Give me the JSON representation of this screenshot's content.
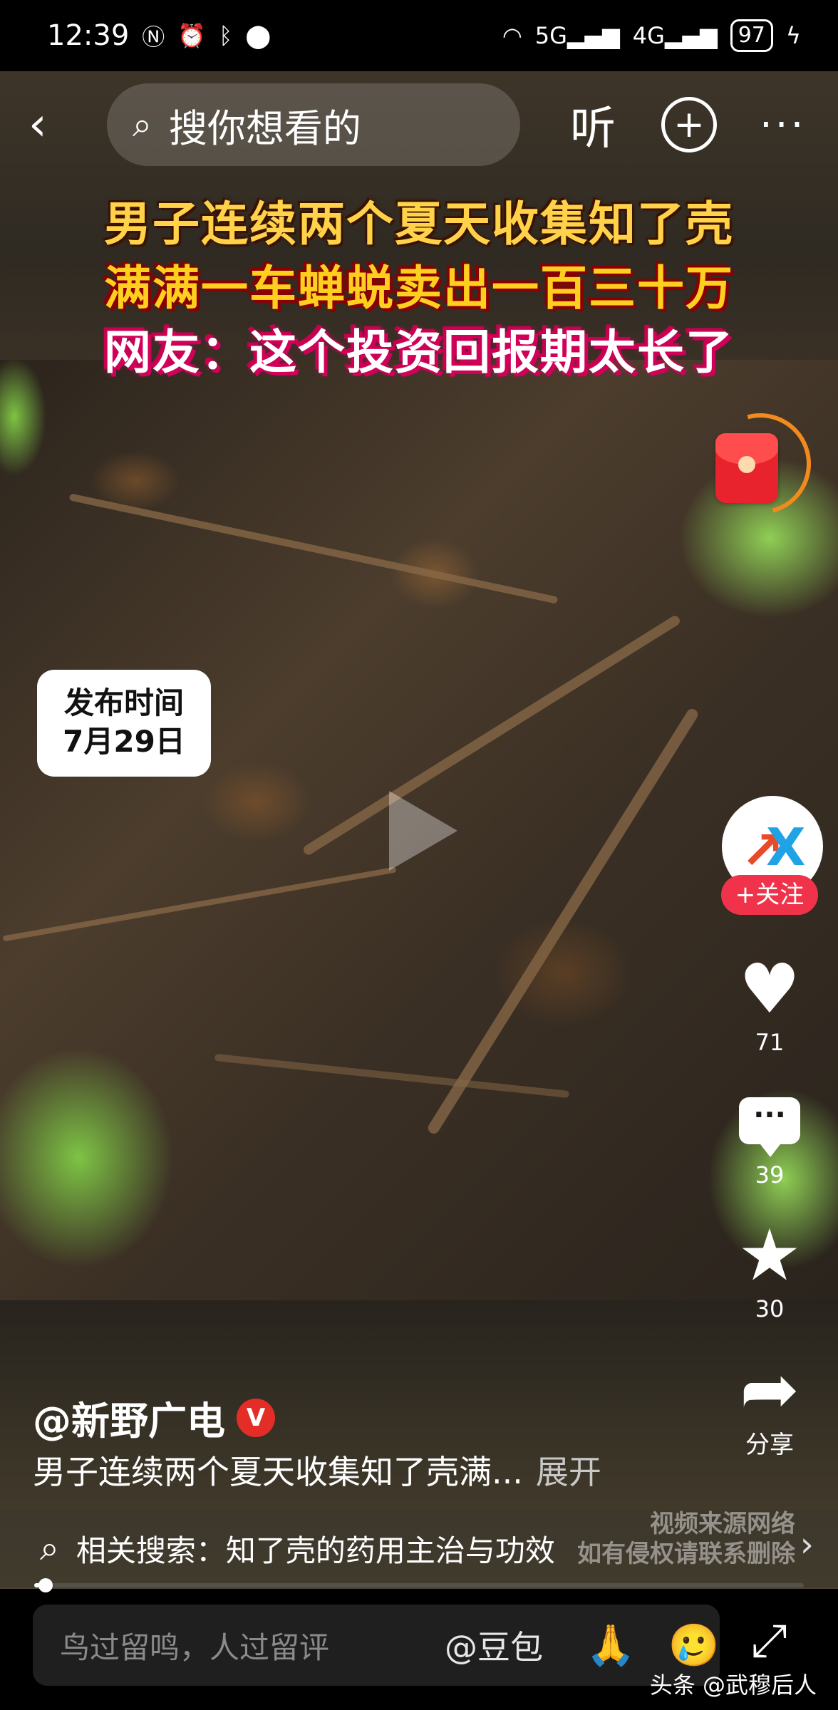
{
  "status_bar": {
    "time": "12:39",
    "left_icons": [
      "nfc-icon",
      "alarm-icon",
      "bluetooth-icon",
      "location-icon"
    ],
    "right_icons": [
      "wifi-icon",
      "signal-5g-icon",
      "signal-4g-icon"
    ],
    "network_5g": "5G",
    "network_4g": "4G",
    "battery": "97"
  },
  "top_bar": {
    "search_placeholder": "搜你想看的",
    "listen_label": "听",
    "add_label": "+",
    "more_label": "···",
    "back_label": "‹"
  },
  "video": {
    "headline_lines": [
      "男子连续两个夏天收集知了壳",
      "满满一车蝉蜕卖出一百三十万",
      "网友：这个投资回报期太长了"
    ],
    "date_badge": [
      "发布时间",
      "7月29日"
    ],
    "progress": 0.015
  },
  "side_actions": {
    "follow_label": "+关注",
    "avatar_text": "X",
    "like_count": "71",
    "comment_count": "39",
    "favorite_count": "30",
    "share_label": "分享"
  },
  "post": {
    "author": "@新野广电",
    "verified_label": "V",
    "description": "男子连续两个夏天收集知了壳满...",
    "expand_label": "展开"
  },
  "related": {
    "text": "相关搜索：知了壳的药用主治与功效",
    "watermark_line1": "视频来源网络",
    "watermark_line2": "如有侵权请联系删除",
    "arrow": "›"
  },
  "comment_bar": {
    "placeholder": "鸟过留鸣，人过留评",
    "mention": "@豆包",
    "emoji_pray": "🙏",
    "emoji_cry": "🥲",
    "attribution": "头条 @武穆后人"
  }
}
